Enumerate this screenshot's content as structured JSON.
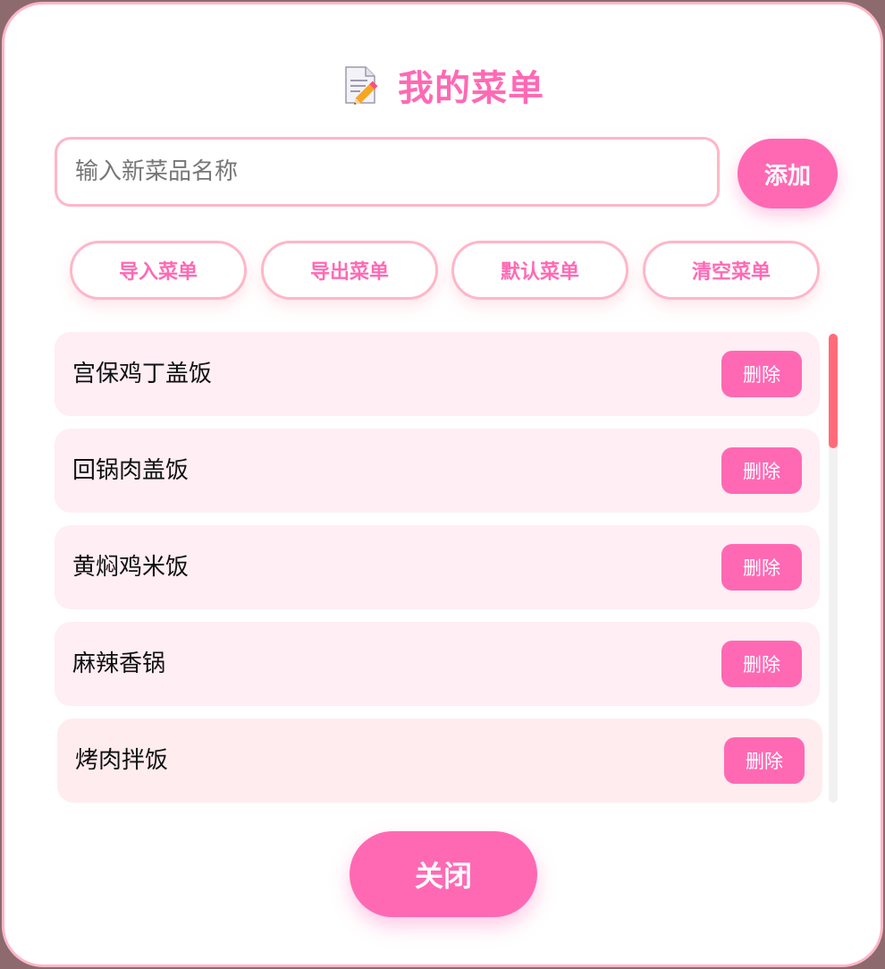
{
  "header": {
    "icon": "memo-pencil-icon",
    "title": "我的菜单"
  },
  "new_dish": {
    "placeholder": "输入新菜品名称",
    "value": "",
    "add_label": "添加"
  },
  "actions": {
    "import_label": "导入菜单",
    "export_label": "导出菜单",
    "default_label": "默认菜单",
    "clear_label": "清空菜单"
  },
  "menu": {
    "delete_label": "删除",
    "items": [
      {
        "name": "宫保鸡丁盖饭"
      },
      {
        "name": "回锅肉盖饭"
      },
      {
        "name": "黄焖鸡米饭"
      },
      {
        "name": "麻辣香锅"
      },
      {
        "name": "烤肉拌饭"
      }
    ]
  },
  "footer": {
    "close_label": "关闭"
  },
  "colors": {
    "accent": "#ff69b4",
    "border": "#ffb6c8",
    "item_bg": "#ffeef4",
    "scroll_thumb": "#ff6b7a"
  }
}
